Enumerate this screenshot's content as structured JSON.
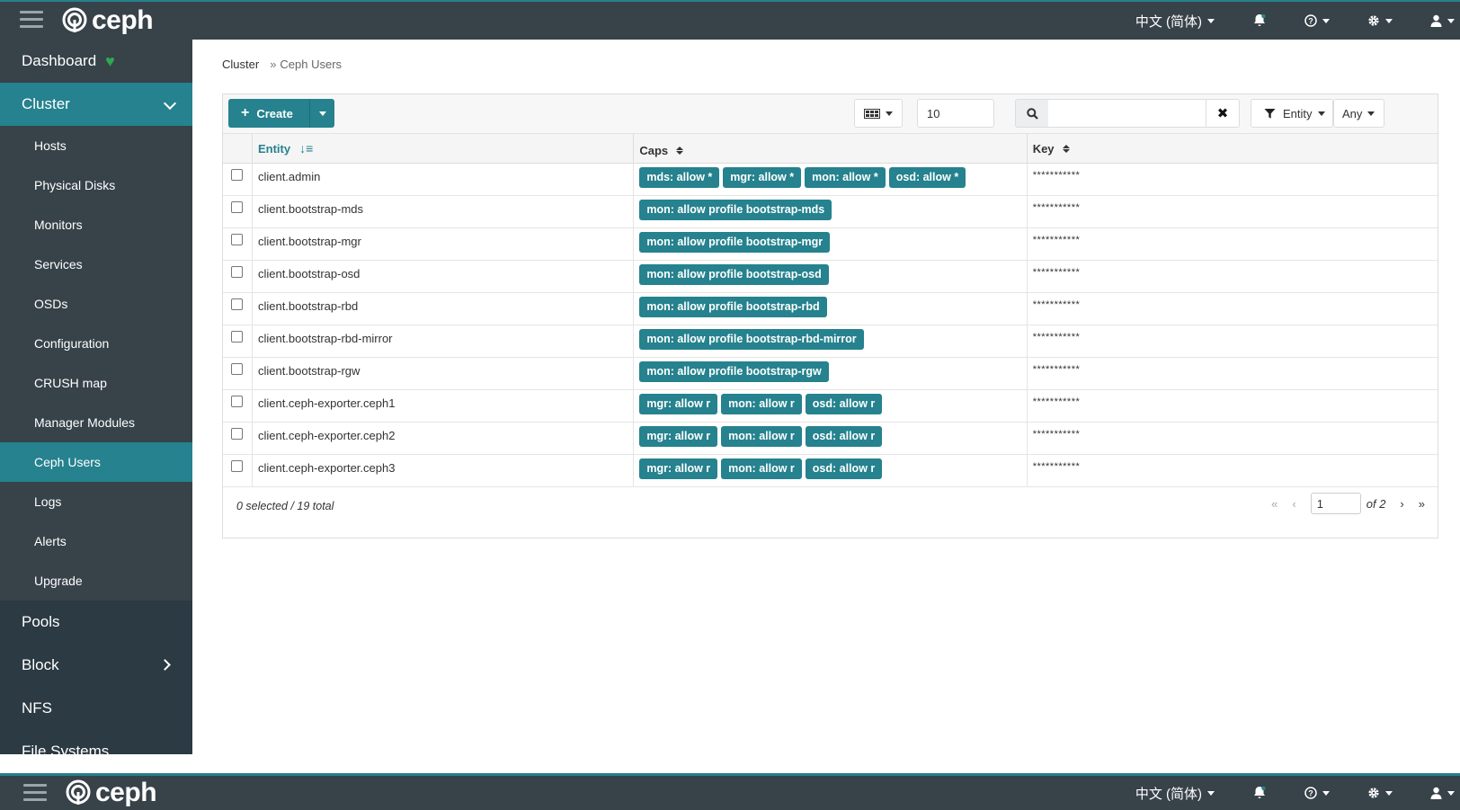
{
  "app": {
    "brand": "ceph",
    "language": "中文 (简体)"
  },
  "sidebar": {
    "dashboard": "Dashboard",
    "cluster": "Cluster",
    "cluster_items": [
      "Hosts",
      "Physical Disks",
      "Monitors",
      "Services",
      "OSDs",
      "Configuration",
      "CRUSH map",
      "Manager Modules",
      "Ceph Users",
      "Logs",
      "Alerts",
      "Upgrade"
    ],
    "active_item": "Ceph Users",
    "pools": "Pools",
    "block": "Block",
    "nfs": "NFS",
    "file_systems": "File Systems"
  },
  "breadcrumb": {
    "parent": "Cluster",
    "separator": "»",
    "current": "Ceph Users"
  },
  "toolbar": {
    "create_label": "Create",
    "page_size": "10",
    "search_value": "",
    "filter_label": "Entity",
    "filter_value": "Any"
  },
  "table": {
    "headers": {
      "entity": "Entity",
      "caps": "Caps",
      "key": "Key"
    },
    "rows": [
      {
        "entity": "client.admin",
        "caps": [
          "mds: allow *",
          "mgr: allow *",
          "mon: allow *",
          "osd: allow *"
        ],
        "key": "***********"
      },
      {
        "entity": "client.bootstrap-mds",
        "caps": [
          "mon: allow profile bootstrap-mds"
        ],
        "key": "***********"
      },
      {
        "entity": "client.bootstrap-mgr",
        "caps": [
          "mon: allow profile bootstrap-mgr"
        ],
        "key": "***********"
      },
      {
        "entity": "client.bootstrap-osd",
        "caps": [
          "mon: allow profile bootstrap-osd"
        ],
        "key": "***********"
      },
      {
        "entity": "client.bootstrap-rbd",
        "caps": [
          "mon: allow profile bootstrap-rbd"
        ],
        "key": "***********"
      },
      {
        "entity": "client.bootstrap-rbd-mirror",
        "caps": [
          "mon: allow profile bootstrap-rbd-mirror"
        ],
        "key": "***********"
      },
      {
        "entity": "client.bootstrap-rgw",
        "caps": [
          "mon: allow profile bootstrap-rgw"
        ],
        "key": "***********"
      },
      {
        "entity": "client.ceph-exporter.ceph1",
        "caps": [
          "mgr: allow r",
          "mon: allow r",
          "osd: allow r"
        ],
        "key": "***********"
      },
      {
        "entity": "client.ceph-exporter.ceph2",
        "caps": [
          "mgr: allow r",
          "mon: allow r",
          "osd: allow r"
        ],
        "key": "***********"
      },
      {
        "entity": "client.ceph-exporter.ceph3",
        "caps": [
          "mgr: allow r",
          "mon: allow r",
          "osd: allow r"
        ],
        "key": "***********"
      }
    ],
    "footer": {
      "summary": "0 selected / 19 total",
      "page": "1",
      "of_pages": "of 2"
    }
  },
  "colors": {
    "accent": "#25828e",
    "topbar": "#374249",
    "sidebar": "#2b3a43"
  }
}
